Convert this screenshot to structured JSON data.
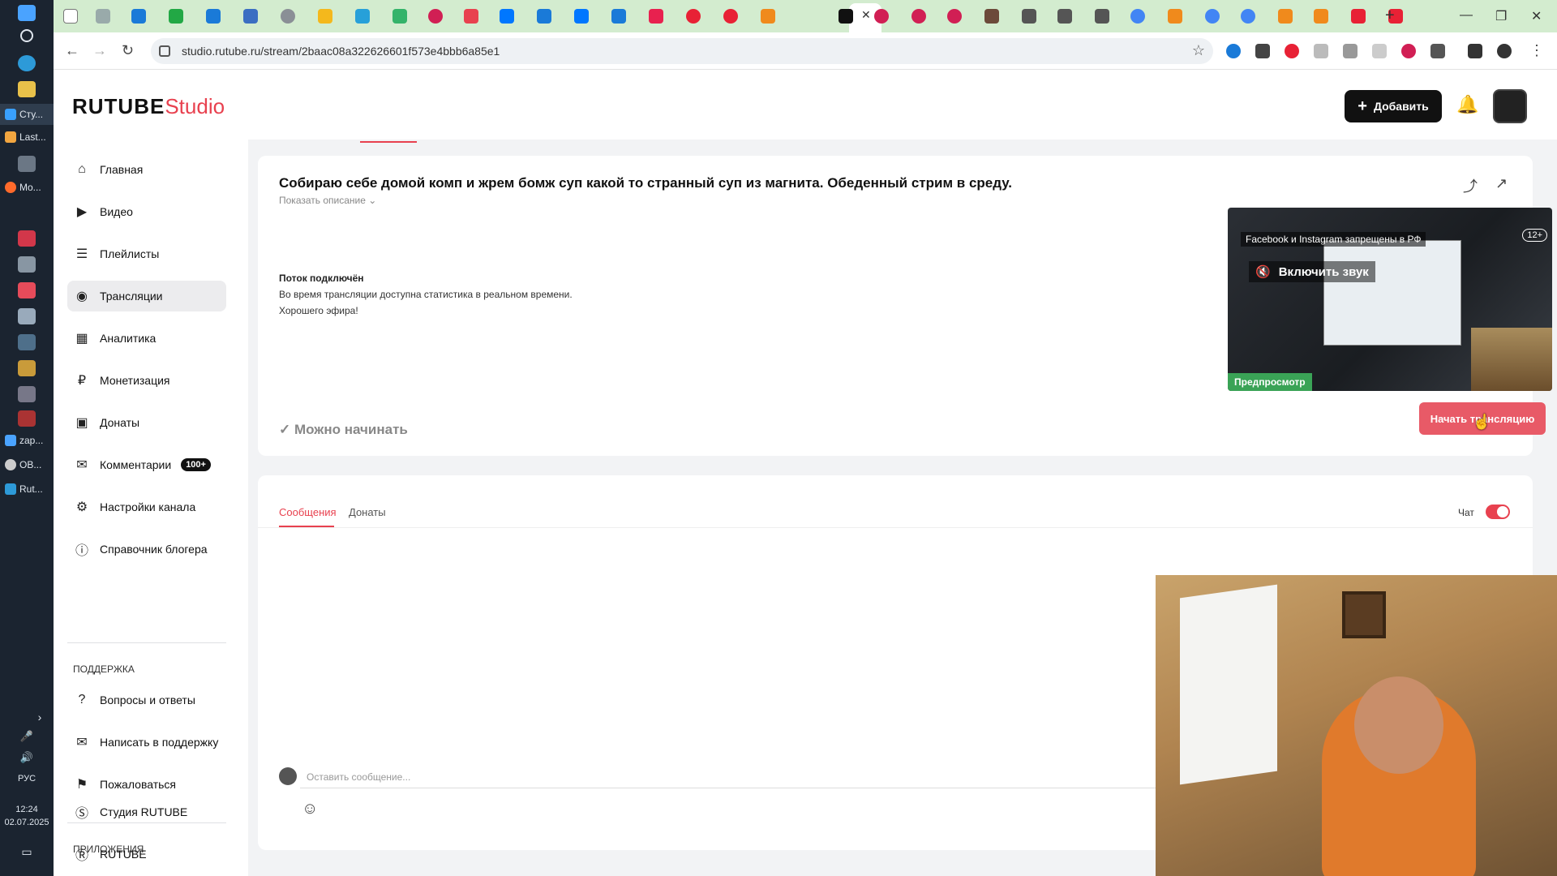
{
  "taskbar": {
    "apps": [
      {
        "label": "Сту..."
      },
      {
        "label": "Last..."
      },
      {
        "label": "Mo..."
      },
      {
        "label": "zap..."
      },
      {
        "label": "OB..."
      },
      {
        "label": "Rut..."
      }
    ],
    "language": "РУС",
    "time": "12:24",
    "date": "02.07.2025"
  },
  "browser": {
    "url": "studio.rutube.ru/stream/2baac08a322626601f573e4bbb6a85e1"
  },
  "header": {
    "logo_main": "RUTUBE",
    "logo_studio": "Studio",
    "add_label": "Добавить"
  },
  "sidebar": {
    "items": [
      {
        "label": "Главная",
        "icon": "home-icon"
      },
      {
        "label": "Видео",
        "icon": "video-icon"
      },
      {
        "label": "Плейлисты",
        "icon": "playlist-icon"
      },
      {
        "label": "Трансляции",
        "icon": "broadcast-icon"
      },
      {
        "label": "Аналитика",
        "icon": "analytics-icon"
      },
      {
        "label": "Монетизация",
        "icon": "ruble-icon"
      },
      {
        "label": "Донаты",
        "icon": "wallet-icon"
      },
      {
        "label": "Комментарии",
        "icon": "comment-icon",
        "badge": "100+"
      },
      {
        "label": "Настройки канала",
        "icon": "gear-icon"
      },
      {
        "label": "Справочник блогера",
        "icon": "info-icon"
      }
    ],
    "support_title": "ПОДДЕРЖКА",
    "support_items": [
      {
        "label": "Вопросы и ответы",
        "icon": "question-icon"
      },
      {
        "label": "Написать в поддержку",
        "icon": "mail-icon"
      },
      {
        "label": "Пожаловаться",
        "icon": "flag-icon"
      }
    ],
    "apps_title": "ПРИЛОЖЕНИЯ",
    "apps_items": [
      {
        "label": "Студия RUTUBE",
        "icon": "studio-icon"
      },
      {
        "label": "RUTUBE",
        "icon": "rutube-icon"
      }
    ]
  },
  "stream": {
    "title": "Собираю себе домой комп и жрем бомж суп какой то странный суп из магнита. Обеденный стрим в среду.",
    "show_description": "Показать описание",
    "status_title": "Поток подключён",
    "status_line1": "Во время трансляции доступна статистика в реальном времени.",
    "status_line2": "Хорошего эфира!",
    "ready_label": "Можно начинать",
    "start_button": "Начать трансляцию",
    "preview": {
      "banner": "Facebook и Instagram запрещены в РФ",
      "age": "12+",
      "unmute": "Включить звук",
      "label": "Предпросмотр"
    }
  },
  "chat": {
    "tabs": [
      "Сообщения",
      "Донаты"
    ],
    "chat_label": "Чат",
    "input_placeholder": "Оставить сообщение..."
  },
  "colors": {
    "accent": "#e8414f",
    "preview_label": "#3aa356",
    "tabstrip": "#d3eccf"
  }
}
